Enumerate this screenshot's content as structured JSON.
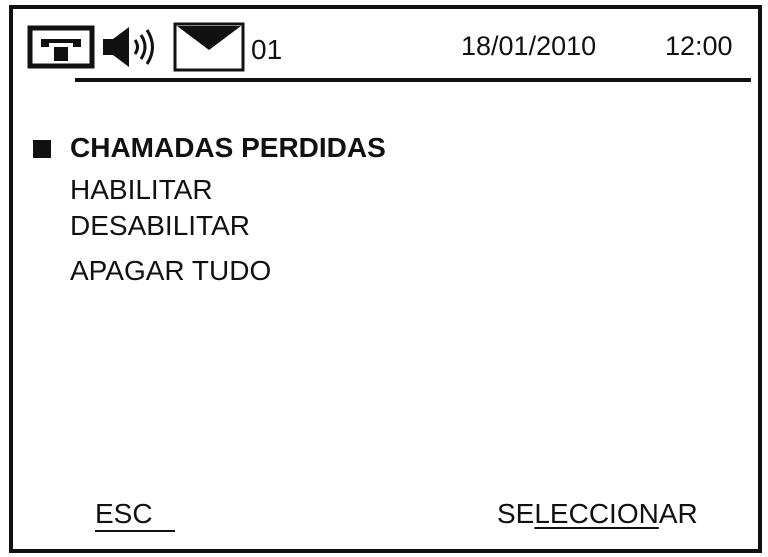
{
  "status_bar": {
    "icons": [
      "telephone-icon",
      "speaker-icon",
      "envelope-icon"
    ],
    "message_count": "01",
    "date": "18/01/2010",
    "time": "12:00"
  },
  "menu": {
    "title": "CHAMADAS PERDIDAS",
    "items": [
      {
        "label": "HABILITAR"
      },
      {
        "label": "DESABILITAR"
      },
      {
        "label": "APAGAR TUDO"
      }
    ]
  },
  "softkeys": {
    "left_label": "ESC",
    "right_label_prefix": "SE",
    "right_label_underlined": "LECCION",
    "right_label_suffix": "AR"
  },
  "colors": {
    "foreground": "#111111",
    "background": "#ffffff"
  }
}
